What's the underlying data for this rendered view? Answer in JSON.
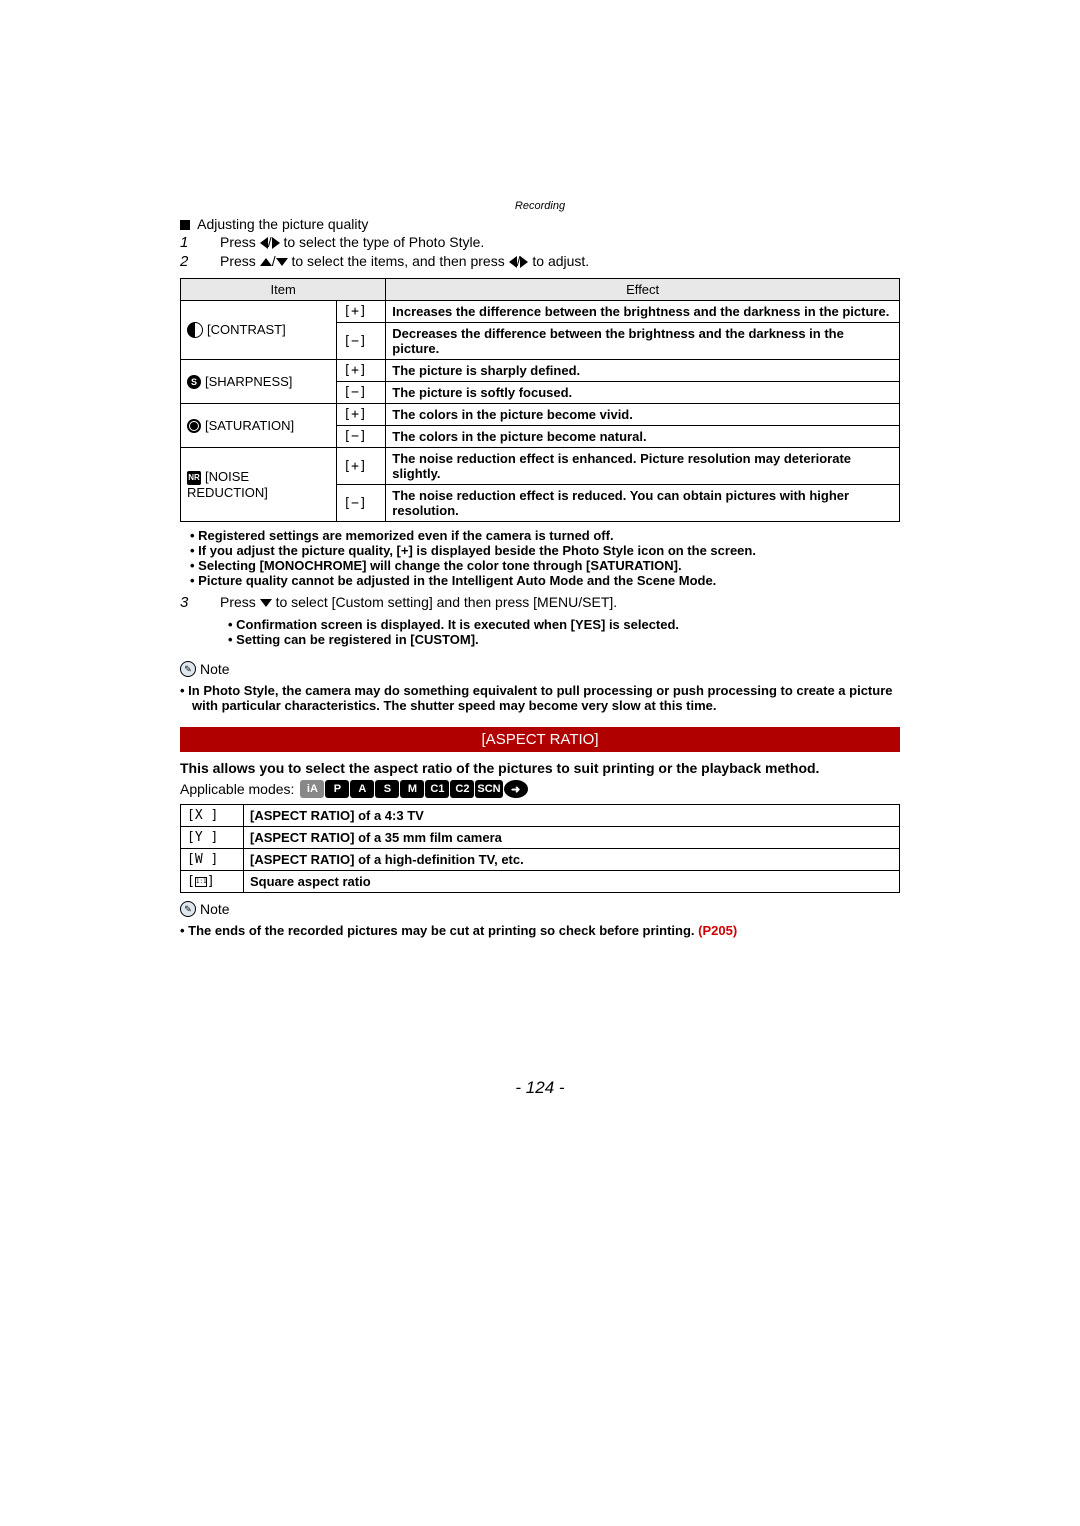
{
  "breadcrumb": "Recording",
  "heading_adjust": "Adjusting the picture quality",
  "step1": {
    "num": "1",
    "before": "Press ",
    "after": " to select the type of Photo Style."
  },
  "step2": {
    "num": "2",
    "before": "Press ",
    "mid": " to select the items, and then press ",
    "after": " to adjust."
  },
  "table_headers": {
    "item": "Item",
    "effect": "Effect"
  },
  "rows": [
    {
      "label": "[CONTRAST]",
      "plus": "Increases the difference between the brightness and the darkness in the picture.",
      "minus": "Decreases the difference between the brightness and the darkness in the picture."
    },
    {
      "label": "[SHARPNESS]",
      "plus": "The picture is sharply defined.",
      "minus": "The picture is softly focused."
    },
    {
      "label": "[SATURATION]",
      "plus": "The colors in the picture become vivid.",
      "minus": "The colors in the picture become natural."
    },
    {
      "label": "[NOISE REDUCTION]",
      "plus": "The noise reduction effect is enhanced. Picture resolution may deteriorate slightly.",
      "minus": "The noise reduction effect is reduced. You can obtain pictures with higher resolution."
    }
  ],
  "sign_plus": "[+]",
  "sign_minus": "[−]",
  "bullets_after_table": [
    "Registered settings are memorized even if the camera is turned off.",
    "If you adjust the picture quality, [+] is displayed beside the Photo Style icon on the screen.",
    "Selecting [MONOCHROME] will change the color tone through [SATURATION].",
    "Picture quality cannot be adjusted in the Intelligent Auto Mode and the Scene Mode."
  ],
  "step3": {
    "num": "3",
    "text_before": "Press ",
    "text_after": " to select [Custom setting] and then press [MENU/SET]."
  },
  "bullets_step3": [
    "Confirmation screen is displayed. It is executed when [YES] is selected.",
    "Setting can be registered in [CUSTOM]."
  ],
  "note_label": "Note",
  "note_bullets_1": [
    "In Photo Style, the camera may do something equivalent to pull processing or push processing to create a picture with particular characteristics. The shutter speed may become very slow at this time."
  ],
  "section_header": "[ASPECT RATIO]",
  "aspect_intro": "This allows you to select the aspect ratio of the pictures to suit printing or the playback method.",
  "applicable_modes_label": "Applicable modes:",
  "modes": [
    "iA",
    "P",
    "A",
    "S",
    "M",
    "C1",
    "C2",
    "SCN"
  ],
  "aspect_rows": [
    {
      "key": "[X  ]",
      "desc": "[ASPECT RATIO] of a 4:3 TV"
    },
    {
      "key": "[Y  ]",
      "desc": "[ASPECT RATIO] of a 35 mm film camera"
    },
    {
      "key": "[W  ]",
      "desc": "[ASPECT RATIO] of a high-definition TV, etc."
    },
    {
      "key": "[  ]",
      "desc": "Square aspect ratio"
    }
  ],
  "note_bullets_2_prefix": "The ends of the recorded pictures may be cut at printing so check before printing. ",
  "note_bullets_2_link": "(P205)",
  "page_number": "- 124 -"
}
